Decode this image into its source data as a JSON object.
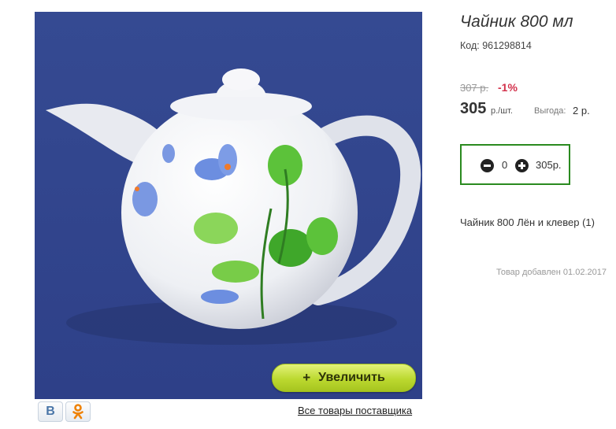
{
  "product": {
    "title": "Чайник 800 мл",
    "code": "Код: 961298814",
    "old_price": "307 р.",
    "discount": "-1%",
    "price": "305",
    "unit": "р./шт.",
    "benefit_label": "Выгода:",
    "benefit_value": "2 р.",
    "set_link": "Чайник 800 Лён и клевер (1)",
    "added_date": "Товар добавлен 01.02.2017"
  },
  "cart": {
    "quantity": "0",
    "sum": "305р."
  },
  "gallery": {
    "zoom_plus": "+",
    "zoom_label": "Увеличить",
    "supplier_link": "Все товары поставщика"
  },
  "share": {
    "vk_letter": "В",
    "vk_icon": "vk-icon",
    "ok_icon": "odnoklassniki-icon"
  },
  "colors": {
    "photo_background": "#3a4d94",
    "zoom_button": "#c6df3a",
    "discount": "#d3324c",
    "cart_border": "#2a8a1f"
  }
}
